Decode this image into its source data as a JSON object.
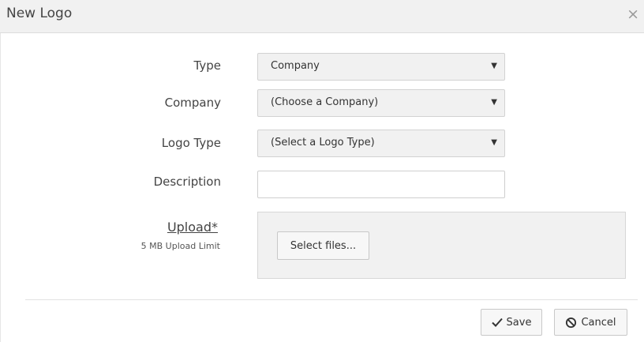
{
  "dialog": {
    "title": "New Logo",
    "close_glyph": "×"
  },
  "form": {
    "type": {
      "label": "Type",
      "value": "Company"
    },
    "company": {
      "label": "Company",
      "value": "(Choose a Company)"
    },
    "logo_type": {
      "label": "Logo Type",
      "value": "(Select a Logo Type)"
    },
    "description": {
      "label": "Description",
      "value": ""
    },
    "upload": {
      "label": "Upload*",
      "limit": "5 MB Upload Limit",
      "button": "Select files..."
    }
  },
  "footer": {
    "save_label": "Save",
    "cancel_label": "Cancel"
  },
  "icons": {
    "dropdown": "dropdown-arrow-icon",
    "save": "checkmark-icon",
    "cancel": "ban-icon",
    "close": "close-icon"
  },
  "dropdown_glyph": "▼"
}
